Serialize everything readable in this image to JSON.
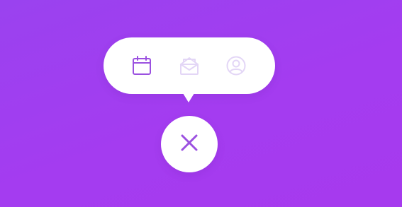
{
  "colors": {
    "background_start": "#9a42ef",
    "background_end": "#a63aee",
    "surface": "#ffffff",
    "icon_active": "#9b51e0",
    "icon_inactive": "#e3d6f6",
    "close_icon": "#9b51e0"
  },
  "menu": {
    "items": [
      {
        "icon": "calendar-icon",
        "state": "active"
      },
      {
        "icon": "mail-icon",
        "state": "inactive"
      },
      {
        "icon": "profile-icon",
        "state": "inactive"
      }
    ]
  },
  "close_button": {
    "icon": "close-icon"
  }
}
